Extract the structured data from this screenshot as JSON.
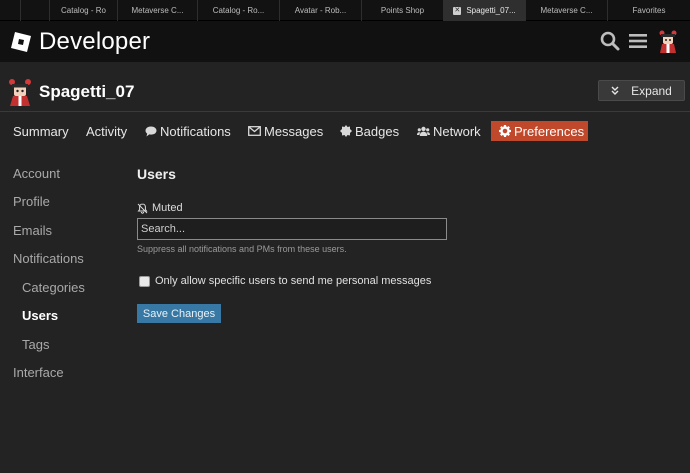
{
  "browser_tabs": [
    {
      "label": "",
      "active": false
    },
    {
      "label": "Catalog - Ro",
      "active": false
    },
    {
      "label": "Metaverse C...",
      "active": false
    },
    {
      "label": "Catalog - Ro...",
      "active": false
    },
    {
      "label": "Avatar - Rob...",
      "active": false
    },
    {
      "label": "Points Shop",
      "active": false
    },
    {
      "label": "Spagetti_07...",
      "active": true
    },
    {
      "label": "Metaverse C...",
      "active": false
    },
    {
      "label": "Favorites",
      "active": false
    }
  ],
  "header": {
    "brand": "Developer",
    "icons": [
      "search-icon",
      "menu-icon",
      "user-avatar"
    ]
  },
  "profile": {
    "username": "Spagetti_07",
    "expand_label": "Expand"
  },
  "nav_tabs": [
    {
      "label": "Summary",
      "icon": null,
      "active": false
    },
    {
      "label": "Activity",
      "icon": null,
      "active": false
    },
    {
      "label": "Notifications",
      "icon": "comment-icon",
      "active": false
    },
    {
      "label": "Messages",
      "icon": "envelope-icon",
      "active": false
    },
    {
      "label": "Badges",
      "icon": "badge-icon",
      "active": false
    },
    {
      "label": "Network",
      "icon": "users-icon",
      "active": false
    },
    {
      "label": "Preferences",
      "icon": "gear-icon",
      "active": true
    }
  ],
  "sidebar": {
    "items": [
      {
        "label": "Account",
        "sub": false,
        "current": false
      },
      {
        "label": "Profile",
        "sub": false,
        "current": false
      },
      {
        "label": "Emails",
        "sub": false,
        "current": false
      },
      {
        "label": "Notifications",
        "sub": false,
        "current": false
      },
      {
        "label": "Categories",
        "sub": true,
        "current": false
      },
      {
        "label": "Users",
        "sub": true,
        "current": true
      },
      {
        "label": "Tags",
        "sub": true,
        "current": false
      },
      {
        "label": "Interface",
        "sub": false,
        "current": false
      }
    ]
  },
  "main": {
    "title": "Users",
    "muted_label": "Muted",
    "search_placeholder": "Search...",
    "search_value": "",
    "help_text": "Suppress all notifications and PMs from these users.",
    "checkbox_label": "Only allow specific users to send me personal messages",
    "checkbox_checked": false,
    "save_label": "Save Changes"
  },
  "colors": {
    "accent": "#c0482b",
    "button": "#3779a4",
    "background": "#232323",
    "topbar": "#111111"
  }
}
